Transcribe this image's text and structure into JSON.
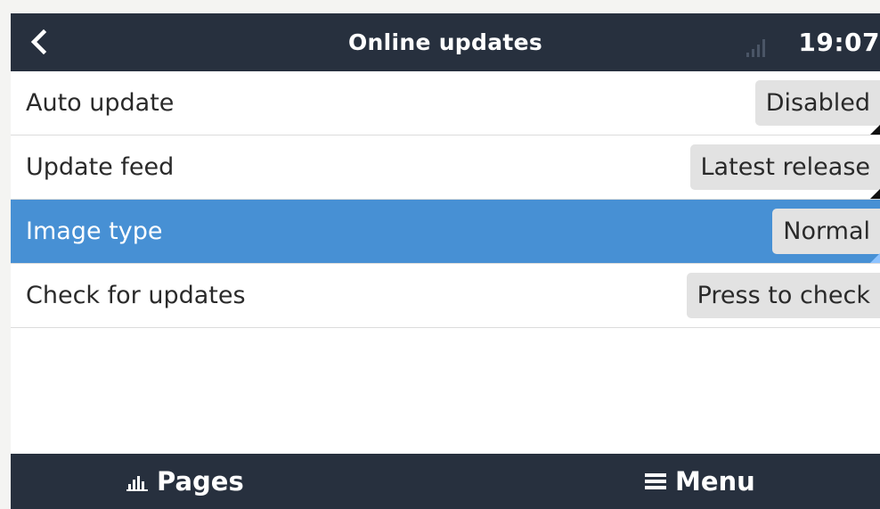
{
  "header": {
    "title": "Online updates",
    "clock": "19:07",
    "back_icon": "chevron-left-icon",
    "signal_icon": "signal-bars-icon"
  },
  "items": [
    {
      "label": "Auto update",
      "value": "Disabled",
      "selected": false
    },
    {
      "label": "Update feed",
      "value": "Latest release",
      "selected": false
    },
    {
      "label": "Image type",
      "value": "Normal",
      "selected": true
    },
    {
      "label": "Check for updates",
      "value": "Press to check",
      "selected": false
    }
  ],
  "footer": {
    "pages_label": "Pages",
    "menu_label": "Menu",
    "pages_icon": "bar-chart-icon",
    "menu_icon": "hamburger-icon"
  },
  "colors": {
    "header_bg": "#27303e",
    "selected_bg": "#4790d4",
    "value_bg": "#e2e2e2"
  }
}
